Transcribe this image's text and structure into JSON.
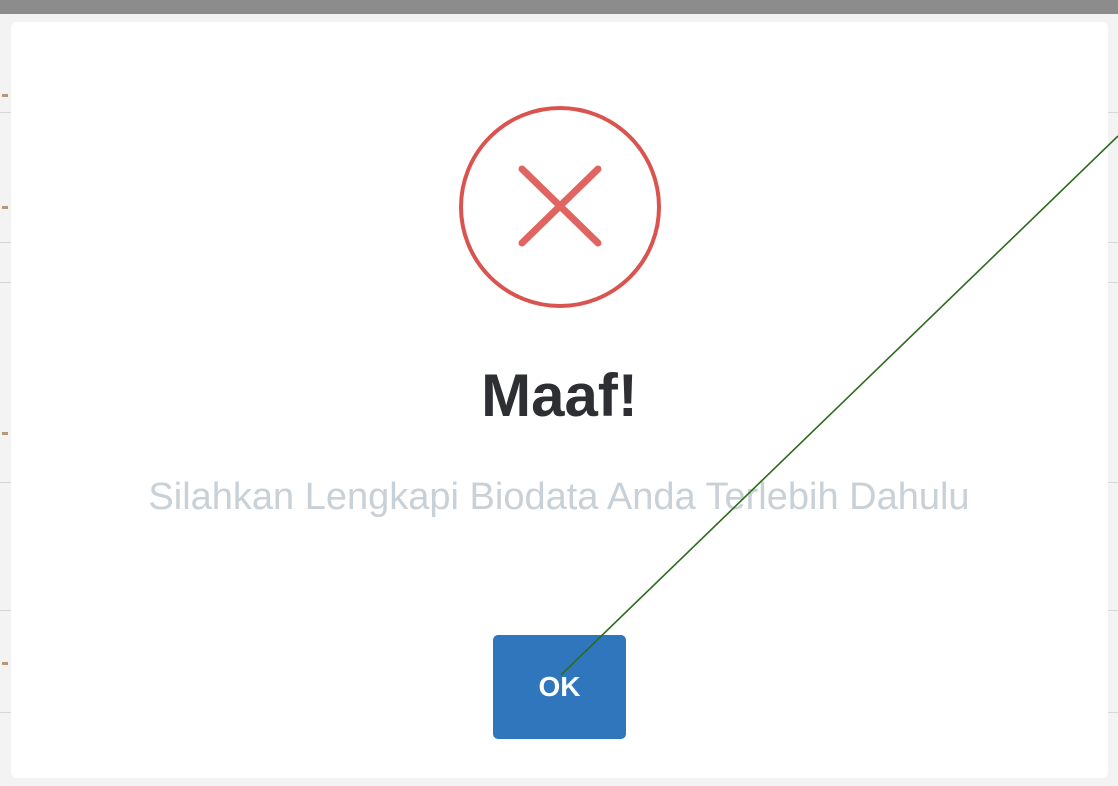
{
  "dialog": {
    "title": "Maaf!",
    "message": "Silahkan Lengkapi Biodata Anda Terlebih Dahulu",
    "confirm_label": "OK",
    "icon": "error-x-icon"
  },
  "colors": {
    "error": "#d9534f",
    "button": "#2f76bd",
    "title": "#2e2f33",
    "message": "#c8d0d8",
    "annotation_line": "#2e6b1f"
  }
}
